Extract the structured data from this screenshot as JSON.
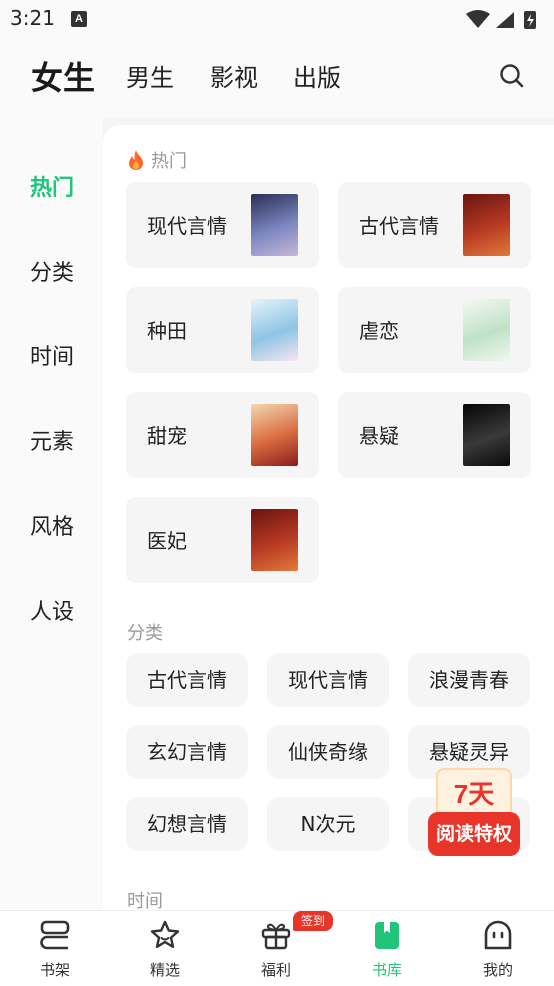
{
  "status": {
    "time": "3:21",
    "a_icon": "A"
  },
  "topnav": {
    "tabs": [
      {
        "label": "女生",
        "active": true
      },
      {
        "label": "男生"
      },
      {
        "label": "影视"
      },
      {
        "label": "出版"
      }
    ],
    "search_icon": "search-icon"
  },
  "sidebar": {
    "items": [
      {
        "label": "热门",
        "active": true
      },
      {
        "label": "分类"
      },
      {
        "label": "时间"
      },
      {
        "label": "元素"
      },
      {
        "label": "风格"
      },
      {
        "label": "人设"
      }
    ]
  },
  "hot": {
    "title": "热门",
    "cards": [
      {
        "label": "现代言情",
        "cover_color": "#5a6aa8"
      },
      {
        "label": "古代言情",
        "cover_color": "#9a2a1e"
      },
      {
        "label": "种田",
        "cover_color": "#a9d6ee"
      },
      {
        "label": "虐恋",
        "cover_color": "#cfe9d8"
      },
      {
        "label": "甜宠",
        "cover_color": "#d9744a"
      },
      {
        "label": "悬疑",
        "cover_color": "#1a1a1a"
      },
      {
        "label": "医妃",
        "cover_color": "#9a2a1e"
      }
    ]
  },
  "category": {
    "title": "分类",
    "pills": [
      "古代言情",
      "现代言情",
      "浪漫青春",
      "玄幻言情",
      "仙侠奇缘",
      "悬疑灵异",
      "幻想言情",
      "N次元"
    ]
  },
  "time_section": {
    "title": "时间"
  },
  "promo": {
    "days": "7天",
    "label": "阅读特权"
  },
  "tabbar": {
    "items": [
      {
        "label": "书架",
        "icon": "bookshelf-icon"
      },
      {
        "label": "精选",
        "icon": "star-icon"
      },
      {
        "label": "福利",
        "icon": "gift-icon",
        "badge": "签到"
      },
      {
        "label": "书库",
        "icon": "book-icon",
        "active": true
      },
      {
        "label": "我的",
        "icon": "profile-icon"
      }
    ]
  },
  "colors": {
    "accent": "#21c47b",
    "promo_red": "#e8352a"
  }
}
